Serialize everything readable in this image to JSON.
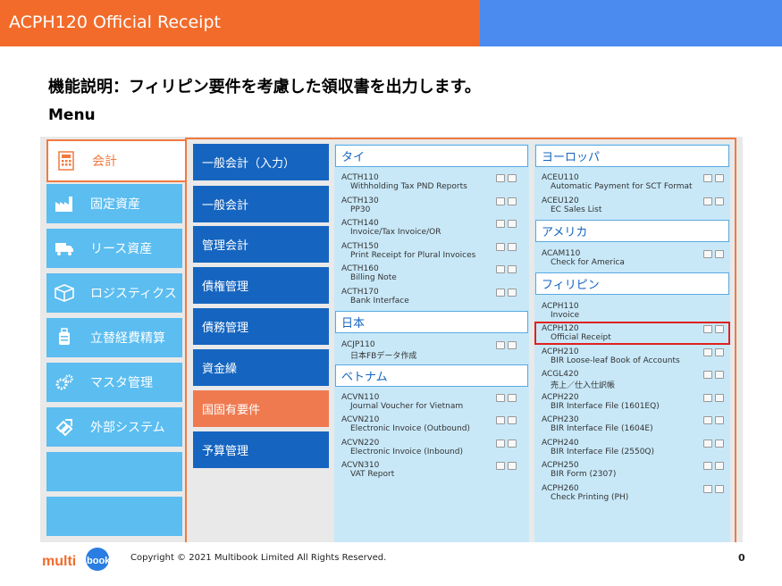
{
  "header": {
    "title": "ACPH120 Official Receipt"
  },
  "description": "機能説明：フィリピン要件を考慮した領収書を出力します。",
  "menu_label": "Menu",
  "categories": [
    {
      "label": "会計",
      "icon": "calculator-icon"
    },
    {
      "label": "固定資産",
      "icon": "factory-icon"
    },
    {
      "label": "リース資産",
      "icon": "truck-icon"
    },
    {
      "label": "ロジスティクス",
      "icon": "box-icon"
    },
    {
      "label": "立替経費精算",
      "icon": "luggage-icon"
    },
    {
      "label": "マスタ管理",
      "icon": "gears-icon"
    },
    {
      "label": "外部システム",
      "icon": "external-link-icon"
    }
  ],
  "submenu": [
    {
      "label": "一般会計（入力）"
    },
    {
      "label": "一般会計"
    },
    {
      "label": "管理会計"
    },
    {
      "label": "債権管理"
    },
    {
      "label": "債務管理"
    },
    {
      "label": "資金繰"
    },
    {
      "label": "国固有要件"
    },
    {
      "label": "予算管理"
    }
  ],
  "left_panel": {
    "thailand": {
      "title": "タイ",
      "items": [
        {
          "code": "ACTH110",
          "name": "Withholding Tax PND Reports"
        },
        {
          "code": "ACTH130",
          "name": "PP30"
        },
        {
          "code": "ACTH140",
          "name": "Invoice/Tax Invoice/OR"
        },
        {
          "code": "ACTH150",
          "name": "Print Receipt for Plural Invoices"
        },
        {
          "code": "ACTH160",
          "name": "Billing Note"
        },
        {
          "code": "ACTH170",
          "name": "Bank Interface"
        }
      ]
    },
    "japan": {
      "title": "日本",
      "items": [
        {
          "code": "ACJP110",
          "name": "日本FBデータ作成"
        }
      ]
    },
    "vietnam": {
      "title": "ベトナム",
      "items": [
        {
          "code": "ACVN110",
          "name": "Journal Voucher for Vietnam"
        },
        {
          "code": "ACVN210",
          "name": "Electronic Invoice (Outbound)"
        },
        {
          "code": "ACVN220",
          "name": "Electronic Invoice (Inbound)"
        },
        {
          "code": "ACVN310",
          "name": "VAT Report"
        }
      ]
    }
  },
  "right_panel": {
    "europe": {
      "title": "ヨーロッパ",
      "items": [
        {
          "code": "ACEU110",
          "name": "Automatic Payment for SCT Format"
        },
        {
          "code": "ACEU120",
          "name": "EC Sales List"
        }
      ]
    },
    "america": {
      "title": "アメリカ",
      "items": [
        {
          "code": "ACAM110",
          "name": "Check for America"
        }
      ]
    },
    "philippines": {
      "title": "フィリピン",
      "items": [
        {
          "code": "ACPH110",
          "name": "Invoice"
        },
        {
          "code": "ACPH120",
          "name": "Official Receipt"
        },
        {
          "code": "ACPH210",
          "name": "BIR Loose-leaf Book of Accounts"
        },
        {
          "code": "ACGL420",
          "name": "売上／仕入仕訳帳"
        },
        {
          "code": "ACPH220",
          "name": "BIR Interface File (1601EQ)"
        },
        {
          "code": "ACPH230",
          "name": "BIR Interface File (1604E)"
        },
        {
          "code": "ACPH240",
          "name": "BIR Interface File (2550Q)"
        },
        {
          "code": "ACPH250",
          "name": "BIR Form (2307)"
        },
        {
          "code": "ACPH260",
          "name": "Check Printing (PH)"
        }
      ]
    }
  },
  "footer": {
    "copyright": "Copyright © 2021 Multibook Limited All Rights Reserved.",
    "page": "0",
    "logo": "multibook"
  },
  "colors": {
    "orange": "#f26b2a",
    "blue": "#4b8bef",
    "nav_blue": "#1565c0",
    "sky": "#5bbdf0",
    "highlight": "#e02020"
  }
}
